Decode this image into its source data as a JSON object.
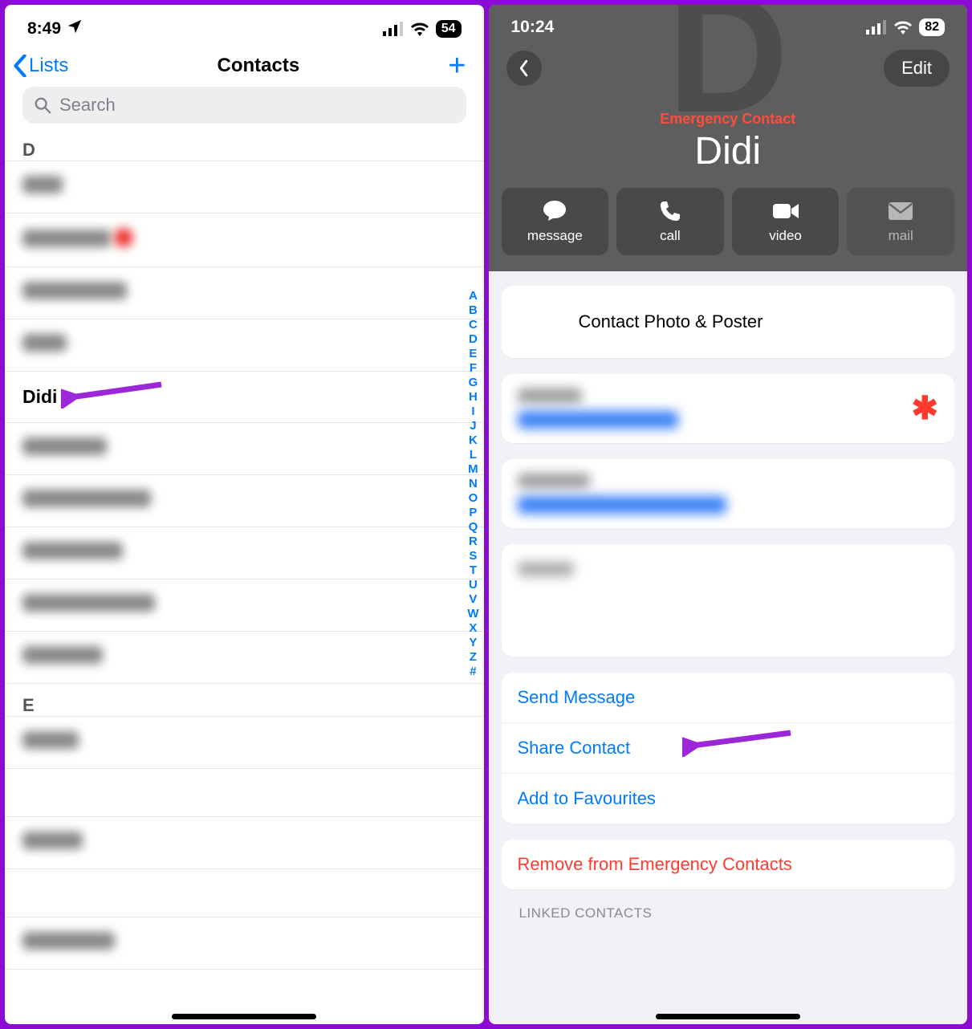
{
  "left": {
    "status": {
      "time": "8:49",
      "battery": "54"
    },
    "nav": {
      "back": "Lists",
      "title": "Contacts"
    },
    "search": {
      "placeholder": "Search"
    },
    "sections": {
      "d": "D",
      "e": "E"
    },
    "didi_row": "Didi",
    "index": [
      "A",
      "B",
      "C",
      "D",
      "E",
      "F",
      "G",
      "H",
      "I",
      "J",
      "K",
      "L",
      "M",
      "N",
      "O",
      "P",
      "Q",
      "R",
      "S",
      "T",
      "U",
      "V",
      "W",
      "X",
      "Y",
      "Z",
      "#"
    ]
  },
  "right": {
    "status": {
      "time": "10:24",
      "battery": "82"
    },
    "nav": {
      "edit": "Edit"
    },
    "emergency": "Emergency Contact",
    "name": "Didi",
    "actions": {
      "message": "message",
      "call": "call",
      "video": "video",
      "mail": "mail"
    },
    "photo_poster": "Contact Photo & Poster",
    "send_message": "Send Message",
    "share_contact": "Share Contact",
    "add_fav": "Add to Favourites",
    "remove_emergency": "Remove from Emergency Contacts",
    "linked": "LINKED CONTACTS"
  }
}
